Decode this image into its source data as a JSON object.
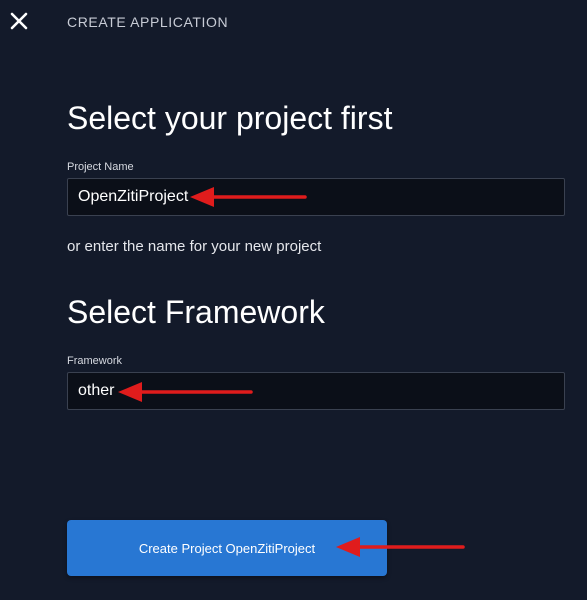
{
  "header": {
    "title": "CREATE APPLICATION",
    "close_icon": "close-icon"
  },
  "project_section": {
    "heading": "Select your project first",
    "field_label": "Project Name",
    "field_value": "OpenZitiProject",
    "helper_text": "or enter the name for your new project"
  },
  "framework_section": {
    "heading": "Select Framework",
    "field_label": "Framework",
    "field_value": "other"
  },
  "create_button": {
    "label": "Create Project OpenZitiProject"
  },
  "annotations": {
    "arrow_color": "#e01c1c"
  },
  "colors": {
    "background": "#131a2a",
    "input_background": "#0b0f18",
    "button_background": "#2877d3"
  }
}
